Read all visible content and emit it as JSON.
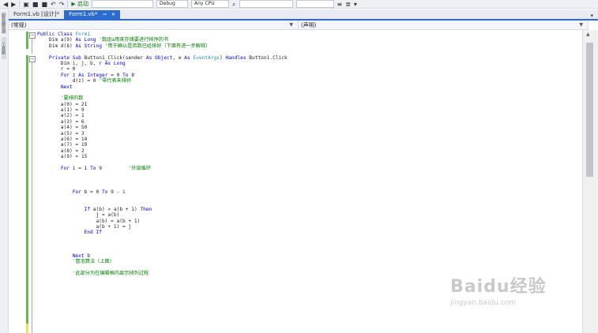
{
  "toolbar": {
    "start_label": "▶ 启动",
    "config_value": "Debug",
    "platform_value": "Any CPU"
  },
  "sidebar": {
    "tabs": [
      "服务器资源管理器",
      "工具箱"
    ]
  },
  "tabs": [
    {
      "label": "Form1.vb [设计]*",
      "active": false
    },
    {
      "label": "Form1.vb*",
      "active": true
    }
  ],
  "navbar": {
    "left": "(常规)",
    "right": "(声明)"
  },
  "code": {
    "lines": [
      [
        {
          "t": "Public ",
          "c": "kw"
        },
        {
          "t": "Class ",
          "c": "kw"
        },
        {
          "t": "Form1",
          "c": "ty"
        }
      ],
      [
        {
          "t": "    Dim a(9) ",
          "c": ""
        },
        {
          "t": "As ",
          "c": "kw"
        },
        {
          "t": "Long",
          "c": "kw"
        },
        {
          "t": " '数组a用来存储要进行排序的书",
          "c": "cm"
        }
      ],
      [
        {
          "t": "    Dim d(8) ",
          "c": ""
        },
        {
          "t": "As ",
          "c": "kw"
        },
        {
          "t": "String",
          "c": "kw"
        },
        {
          "t": " '用于确认是否数已经排好（下面有进一步解释）",
          "c": "cm"
        }
      ],
      [],
      [
        {
          "t": "    ",
          "c": ""
        },
        {
          "t": "Private Sub ",
          "c": "kw"
        },
        {
          "t": "Button1_Click(sender ",
          "c": ""
        },
        {
          "t": "As ",
          "c": "kw"
        },
        {
          "t": "Object",
          "c": "kw"
        },
        {
          "t": ", e ",
          "c": ""
        },
        {
          "t": "As ",
          "c": "kw"
        },
        {
          "t": "EventArgs",
          "c": "ty"
        },
        {
          "t": ") ",
          "c": ""
        },
        {
          "t": "Handles ",
          "c": "kw"
        },
        {
          "t": "Button1.Click",
          "c": ""
        }
      ],
      [
        {
          "t": "        Dim i, j, b, r ",
          "c": ""
        },
        {
          "t": "As ",
          "c": "kw"
        },
        {
          "t": "Long",
          "c": "kw"
        }
      ],
      [
        {
          "t": "        r = 0",
          "c": ""
        }
      ],
      [
        {
          "t": "        ",
          "c": ""
        },
        {
          "t": "For ",
          "c": "kw"
        },
        {
          "t": "z ",
          "c": ""
        },
        {
          "t": "As ",
          "c": "kw"
        },
        {
          "t": "Integer",
          "c": "kw"
        },
        {
          "t": " = 0 ",
          "c": ""
        },
        {
          "t": "To ",
          "c": "kw"
        },
        {
          "t": "8",
          "c": ""
        }
      ],
      [
        {
          "t": "            d(z) = 0 ",
          "c": ""
        },
        {
          "t": "'零代表未排好",
          "c": "cm"
        }
      ],
      [
        {
          "t": "        ",
          "c": ""
        },
        {
          "t": "Next",
          "c": "kw"
        }
      ],
      [],
      [
        {
          "t": "        '要排的数",
          "c": "cm"
        }
      ],
      [
        {
          "t": "        a(0) = 21",
          "c": ""
        }
      ],
      [
        {
          "t": "        a(1) = 9",
          "c": ""
        }
      ],
      [
        {
          "t": "        a(2) = 1",
          "c": ""
        }
      ],
      [
        {
          "t": "        a(3) = 6",
          "c": ""
        }
      ],
      [
        {
          "t": "        a(4) = 50",
          "c": ""
        }
      ],
      [
        {
          "t": "        a(5) = 3",
          "c": ""
        }
      ],
      [
        {
          "t": "        a(6) = 14",
          "c": ""
        }
      ],
      [
        {
          "t": "        a(7) = 19",
          "c": ""
        }
      ],
      [
        {
          "t": "        a(8) = 2",
          "c": ""
        }
      ],
      [
        {
          "t": "        a(9) = 15",
          "c": ""
        }
      ],
      [],
      [
        {
          "t": "        ",
          "c": ""
        },
        {
          "t": "For ",
          "c": "kw"
        },
        {
          "t": "i = 1 ",
          "c": ""
        },
        {
          "t": "To ",
          "c": "kw"
        },
        {
          "t": "9         ",
          "c": ""
        },
        {
          "t": "'外层循环",
          "c": "cm"
        }
      ],
      [],
      [],
      [],
      [
        {
          "t": "            ",
          "c": ""
        },
        {
          "t": "For ",
          "c": "kw"
        },
        {
          "t": "b = 0 ",
          "c": ""
        },
        {
          "t": "To ",
          "c": "kw"
        },
        {
          "t": "9 - i",
          "c": ""
        }
      ],
      [],
      [],
      [
        {
          "t": "                ",
          "c": ""
        },
        {
          "t": "If ",
          "c": "kw"
        },
        {
          "t": "a(b) > a(b + 1) ",
          "c": ""
        },
        {
          "t": "Then",
          "c": "kw"
        }
      ],
      [
        {
          "t": "                    j = a(b)",
          "c": ""
        }
      ],
      [
        {
          "t": "                    a(b) = a(b + 1)",
          "c": ""
        }
      ],
      [
        {
          "t": "                    a(b + 1) = j",
          "c": ""
        }
      ],
      [
        {
          "t": "                ",
          "c": ""
        },
        {
          "t": "End If",
          "c": "kw"
        }
      ],
      [],
      [],
      [],
      [
        {
          "t": "            ",
          "c": ""
        },
        {
          "t": "Next ",
          "c": "kw"
        },
        {
          "t": "b",
          "c": ""
        }
      ],
      [
        {
          "t": "            '冒泡算法（上面）",
          "c": "cm"
        }
      ],
      [],
      [
        {
          "t": "            '此部分为在编辑框内显示排列过程",
          "c": "cm"
        }
      ]
    ]
  },
  "watermark": {
    "logo": "Baidu经验",
    "url": "jingyan.baidu.com"
  }
}
